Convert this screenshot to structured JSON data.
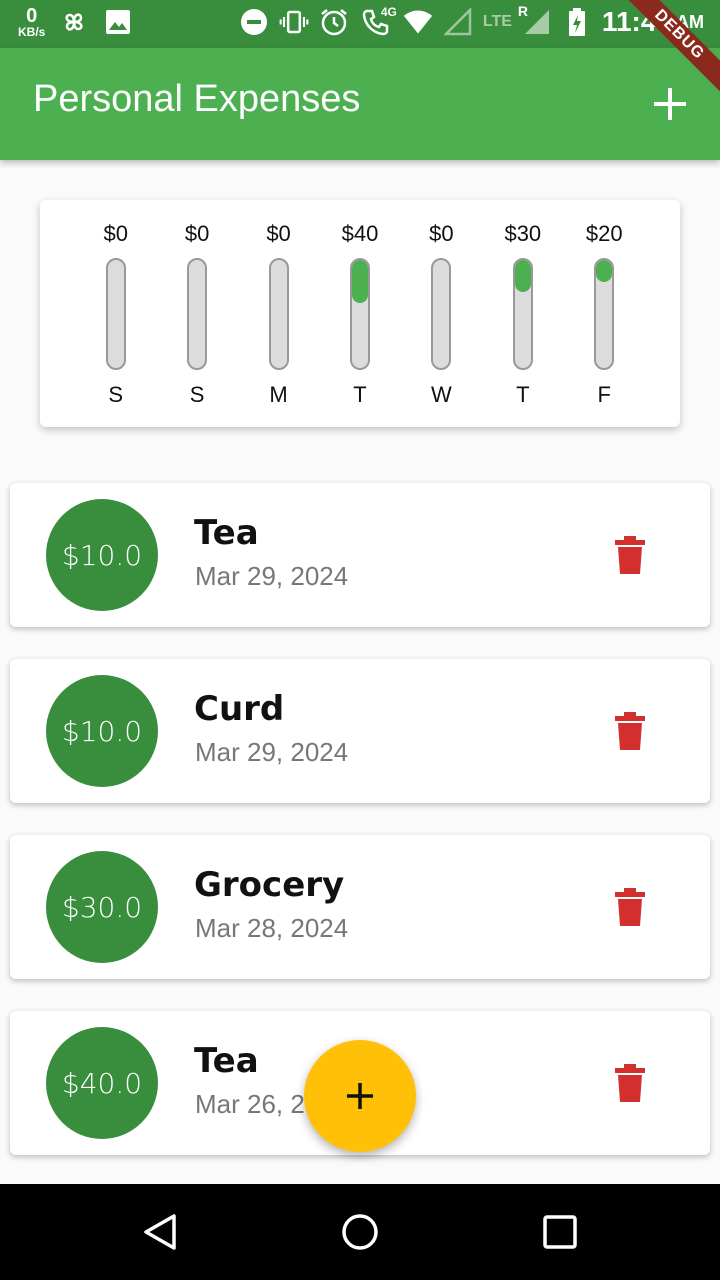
{
  "status_bar": {
    "net_speed_value": "0",
    "net_speed_unit": "KB/s",
    "network_label": "LTE",
    "network_4g_label": "4G",
    "roaming_label": "R",
    "time": "11:43",
    "ampm": "AM"
  },
  "debug_banner": "DEBUG",
  "app_bar": {
    "title": "Personal Expenses"
  },
  "chart_data": {
    "type": "bar",
    "categories": [
      "S",
      "S",
      "M",
      "T",
      "W",
      "T",
      "F"
    ],
    "values": [
      0,
      0,
      0,
      40,
      0,
      30,
      20
    ],
    "amount_labels": [
      "$0",
      "$0",
      "$0",
      "$40",
      "$0",
      "$30",
      "$20"
    ],
    "fill_fractions": [
      0,
      0,
      0,
      0.4,
      0,
      0.3,
      0.2
    ],
    "bar_fill_color": "#4caf50",
    "bar_track_color": "#dcdcdc"
  },
  "transactions": [
    {
      "amount": "$10.0",
      "title": "Tea",
      "date": "Mar 29, 2024"
    },
    {
      "amount": "$10.0",
      "title": "Curd",
      "date": "Mar 29, 2024"
    },
    {
      "amount": "$30.0",
      "title": "Grocery",
      "date": "Mar 28, 2024"
    },
    {
      "amount": "$40.0",
      "title": "Tea",
      "date": "Mar 26, 2024"
    }
  ],
  "colors": {
    "primary": "#4caf50",
    "primary_dark": "#388e3c",
    "accent": "#ffc107",
    "delete": "#d32f2f"
  },
  "icons": {
    "add": "plus-icon",
    "delete": "trash-icon",
    "fab": "plus-icon",
    "nav_back": "triangle-back-icon",
    "nav_home": "circle-home-icon",
    "nav_recents": "square-recents-icon"
  }
}
